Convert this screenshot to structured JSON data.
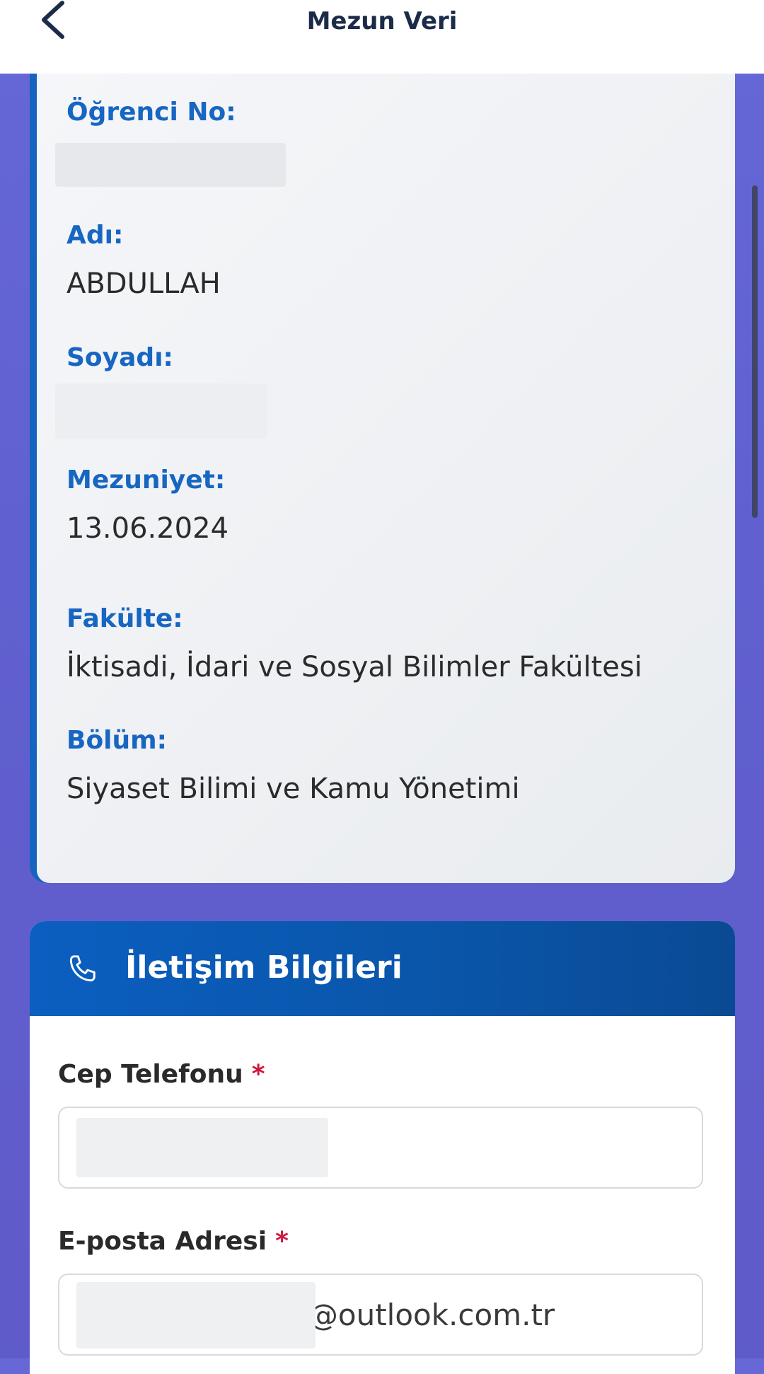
{
  "header": {
    "title": "Mezun Veri",
    "back_icon": "chevron-left-icon"
  },
  "student": {
    "student_no_label": "Öğrenci No:",
    "student_no_value": "",
    "name_label": "Adı:",
    "name_value": "ABDULLAH",
    "surname_label": "Soyadı:",
    "surname_value": "",
    "graduation_label": "Mezuniyet:",
    "graduation_value": "13.06.2024",
    "faculty_label": "Fakülte:",
    "faculty_value": "İktisadi, İdari ve Sosyal Bilimler Fakültesi",
    "department_label": "Bölüm:",
    "department_value": "Siyaset Bilimi ve Kamu Yönetimi"
  },
  "contact": {
    "title": "İletişim Bilgileri",
    "icon": "phone-icon",
    "phone_label": "Cep Telefonu",
    "phone_value": "",
    "email_label": "E-posta Adresi",
    "email_value": "s@outlook.com.tr",
    "required_mark": "*"
  },
  "colors": {
    "accent_blue": "#1766c2",
    "header_blue": "#0b5fc0",
    "required_red": "#d0173f",
    "background_purple": "#6160d0"
  }
}
